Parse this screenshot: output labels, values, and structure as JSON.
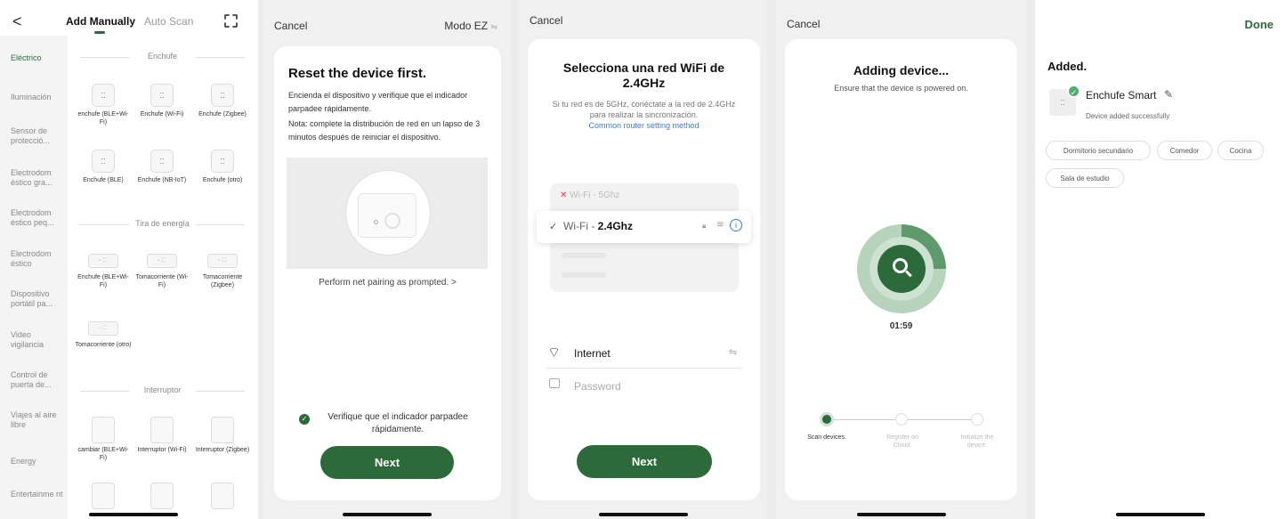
{
  "screen1": {
    "back": "<",
    "tab_manual": "Add Manually",
    "tab_scan": "Auto Scan",
    "sidebar": [
      "Eléctrico",
      "Iluminación",
      "Sensor de protecció...",
      "Electrodom éstico gra...",
      "Electrodom éstico peq...",
      "Electrodom éstico",
      "Dispositivo portátil pa...",
      "Video vigilancia",
      "Control de puerta de...",
      "Viajes al aire libre",
      "Energy",
      "Entertainme nt"
    ],
    "sections": [
      "Enchufe",
      "Tira de energía",
      "Interruptor"
    ],
    "enchufe_items": [
      "enchufe (BLE+Wi-Fi)",
      "Enchufe (Wi-Fi)",
      "Enchufe (Zigbee)",
      "Enchufe (BLE)",
      "Enchufe (NB-IoT)",
      "Enchufe (otro)"
    ],
    "tira_items": [
      "Enchufe (BLE+Wi-Fi)",
      "Tomacorriente (Wi-Fi)",
      "Tomacorriente (Zigbee)",
      "Tomacorriente (otro)"
    ],
    "interruptor_items": [
      "cambiar (BLE+Wi-Fi)",
      "Interruptor (Wi-Fi)",
      "Interruptor (Zigbee)"
    ]
  },
  "screen2": {
    "cancel": "Cancel",
    "mode": "Modo EZ",
    "title": "Reset the device first.",
    "instructions": "Encienda el dispositivo y verifique que el indicador parpadee rápidamente.",
    "note": "Nota: complete la distribución de red en un lapso de 3 minutos después de reiniciar el dispositivo.",
    "prompt_link": "Perform net pairing as prompted. >",
    "confirm": "Verifique que el indicador parpadee rápidamente.",
    "next": "Next"
  },
  "screen3": {
    "cancel": "Cancel",
    "title": "Selecciona una red WiFi de 2.4GHz",
    "subtitle": "Si tu red es de 5GHz, conéctate a la red de 2.4GHz para realizar la sincronización.",
    "link": "Common router setting method",
    "wifi_5": "Wi-Fi - 5Ghz",
    "wifi_24_prefix": "Wi-Fi - ",
    "wifi_24_bold": "2.4Ghz",
    "ssid": "Internet",
    "password_placeholder": "Password",
    "next": "Next"
  },
  "screen4": {
    "cancel": "Cancel",
    "title": "Adding device...",
    "subtitle": "Ensure that the device is powered on.",
    "timer": "01:59",
    "steps": [
      "Scan devices.",
      "Register on Cloud.",
      "Initialize the device."
    ]
  },
  "screen5": {
    "done": "Done",
    "added": "Added.",
    "device_name": "Enchufe Smart",
    "status": "Device added successfully",
    "rooms": [
      "Dormitorio secundario",
      "Comedor",
      "Cocina",
      "Sala de estudio"
    ]
  },
  "colors": {
    "accent_green": "#2d6a3a",
    "link_blue": "#3b7dd8",
    "error_red": "#e53935"
  }
}
